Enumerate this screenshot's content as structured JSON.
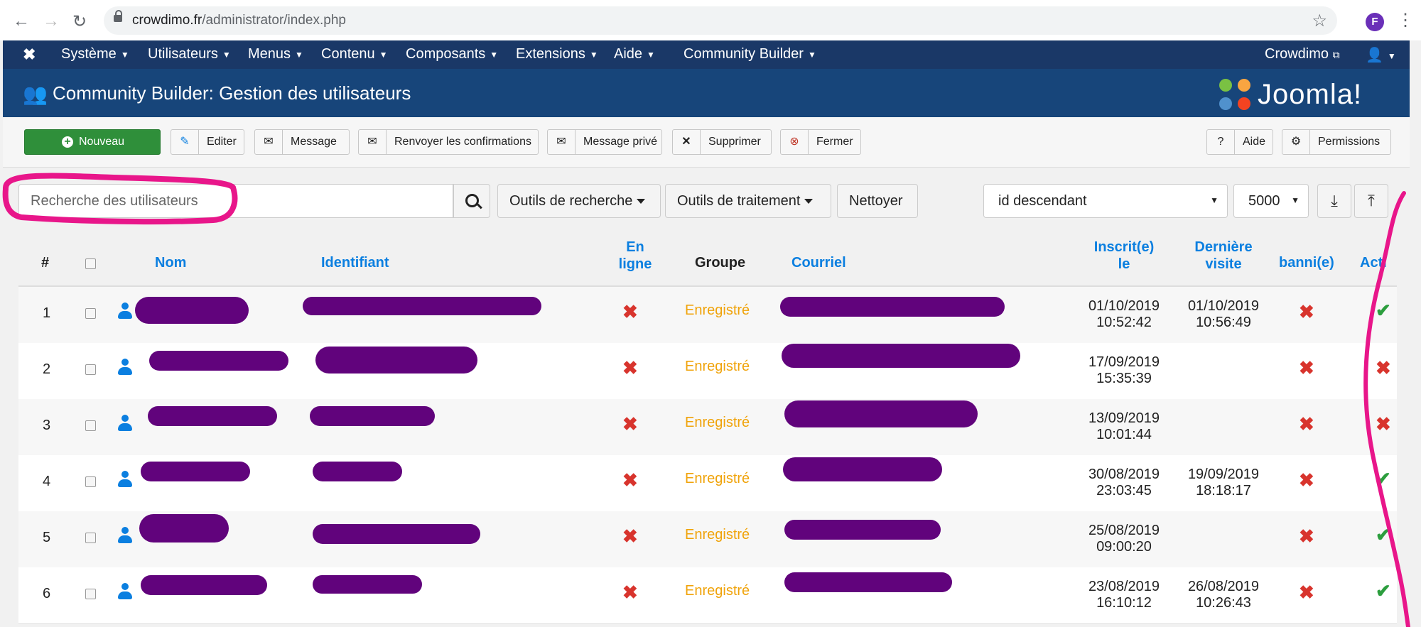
{
  "browser": {
    "url_domain": "crowdimo.fr",
    "url_path": "/administrator/index.php",
    "avatar_letter": "F"
  },
  "topmenu": {
    "items": [
      "Système",
      "Utilisateurs",
      "Menus",
      "Contenu",
      "Composants",
      "Extensions",
      "Aide",
      "Community Builder"
    ],
    "site_link": "Crowdimo"
  },
  "titlebar": {
    "title": "Community Builder: Gestion des utilisateurs",
    "brand": "Joomla!"
  },
  "toolbar": {
    "new": "Nouveau",
    "edit": "Editer",
    "message": "Message",
    "resend": "Renvoyer les confirmations",
    "private_message": "Message privé",
    "delete": "Supprimer",
    "close": "Fermer",
    "help": "Aide",
    "permissions": "Permissions"
  },
  "filters": {
    "search_placeholder": "Recherche des utilisateurs",
    "search_tools": "Outils de recherche",
    "batch_tools": "Outils de traitement",
    "clear": "Nettoyer",
    "ordering": "id descendant",
    "limit": "5000"
  },
  "table": {
    "headers": {
      "num": "#",
      "name": "Nom",
      "username": "Identifiant",
      "online_1": "En",
      "online_2": "ligne",
      "group": "Groupe",
      "email": "Courriel",
      "registered_1": "Inscrit(e)",
      "registered_2": "le",
      "lastvisit_1": "Dernière",
      "lastvisit_2": "visite",
      "banned": "banni(e)",
      "active": "Acti"
    },
    "rows": [
      {
        "num": "1",
        "group": "Enregistré",
        "reg_date": "01/10/2019",
        "reg_time": "10:52:42",
        "last_date": "01/10/2019",
        "last_time": "10:56:49",
        "active": true
      },
      {
        "num": "2",
        "group": "Enregistré",
        "reg_date": "17/09/2019",
        "reg_time": "15:35:39",
        "last_date": "",
        "last_time": "",
        "active": false
      },
      {
        "num": "3",
        "group": "Enregistré",
        "reg_date": "13/09/2019",
        "reg_time": "10:01:44",
        "last_date": "",
        "last_time": "",
        "active": false
      },
      {
        "num": "4",
        "group": "Enregistré",
        "reg_date": "30/08/2019",
        "reg_time": "23:03:45",
        "last_date": "19/09/2019",
        "last_time": "18:18:17",
        "active": true
      },
      {
        "num": "5",
        "group": "Enregistré",
        "reg_date": "25/08/2019",
        "reg_time": "09:00:20",
        "last_date": "",
        "last_time": "",
        "active": true
      },
      {
        "num": "6",
        "group": "Enregistré",
        "reg_date": "23/08/2019",
        "reg_time": "16:10:12",
        "last_date": "26/08/2019",
        "last_time": "10:26:43",
        "active": true
      }
    ]
  },
  "colors": {
    "menu_bg": "#1a3867",
    "title_bg": "#17457a",
    "link": "#0b7fe0",
    "group": "#f0a30a",
    "cross": "#d8342d",
    "check": "#2c9e3e",
    "redaction": "#61037c",
    "highlight": "#e8168a"
  }
}
